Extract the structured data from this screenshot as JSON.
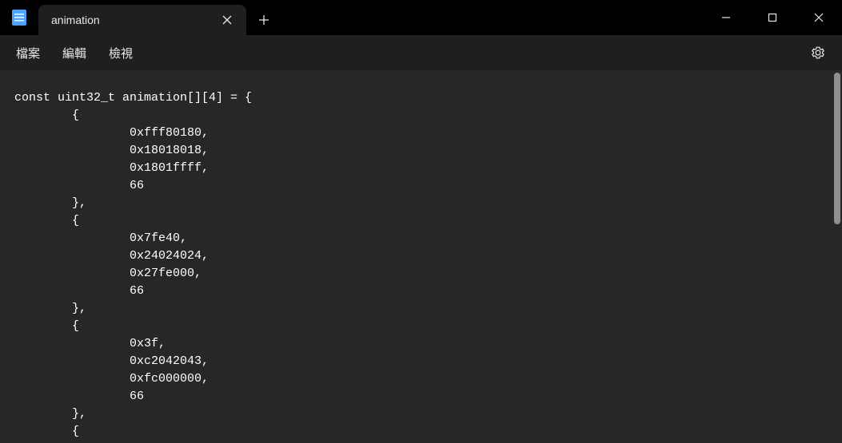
{
  "titlebar": {
    "tab_title": "animation"
  },
  "menu": {
    "file": "檔案",
    "edit": "編輯",
    "view": "檢視"
  },
  "editor": {
    "code": "const uint32_t animation[][4] = {\n\t{\n\t\t0xfff80180,\n\t\t0x18018018,\n\t\t0x1801ffff,\n\t\t66\n\t},\n\t{\n\t\t0x7fe40,\n\t\t0x24024024,\n\t\t0x27fe000,\n\t\t66\n\t},\n\t{\n\t\t0x3f,\n\t\t0xc2042043,\n\t\t0xfc000000,\n\t\t66\n\t},\n\t{"
  }
}
